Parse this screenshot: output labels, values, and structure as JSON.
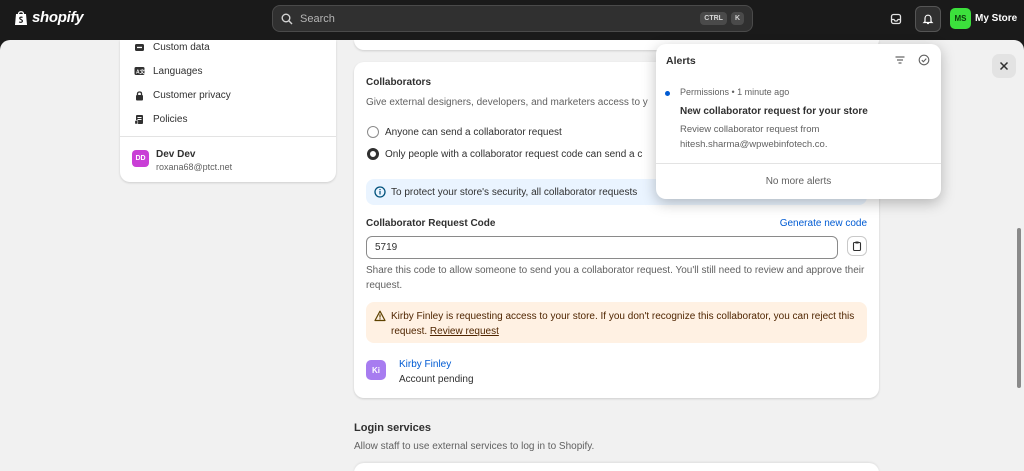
{
  "topbar": {
    "brand": "shopify",
    "search_placeholder": "Search",
    "shortcut_ctrl": "CTRL",
    "shortcut_k": "K",
    "store_initials": "MS",
    "store_name": "My Store"
  },
  "sidebar": {
    "items": [
      {
        "label": "Custom data",
        "icon": "custom-data-icon"
      },
      {
        "label": "Languages",
        "icon": "languages-icon"
      },
      {
        "label": "Customer privacy",
        "icon": "lock-icon"
      },
      {
        "label": "Policies",
        "icon": "policies-icon"
      }
    ],
    "user": {
      "initials": "DD",
      "name": "Dev Dev",
      "email": "roxana68@ptct.net"
    }
  },
  "collaborators": {
    "title": "Collaborators",
    "subtitle": "Give external designers, developers, and marketers access to y",
    "options": [
      {
        "label": "Anyone can send a collaborator request",
        "selected": false
      },
      {
        "label": "Only people with a collaborator request code can send a c",
        "selected": true
      }
    ],
    "info_banner": "To protect your store's security, all collaborator requests",
    "code_label": "Collaborator Request Code",
    "generate_link": "Generate new code",
    "code_value": "5719",
    "help_text": "Share this code to allow someone to send you a collaborator request. You'll still need to review and approve their request.",
    "warning_text": "Kirby Finley is requesting access to your store. If you don't recognize this collaborator, you can reject this request.",
    "warning_link": "Review request",
    "requester": {
      "initials": "Ki",
      "name": "Kirby Finley",
      "status": "Account pending"
    }
  },
  "login_services": {
    "title": "Login services",
    "subtitle": "Allow staff to use external services to log in to Shopify."
  },
  "alerts": {
    "title": "Alerts",
    "item": {
      "meta": "Permissions • 1 minute ago",
      "heading": "New collaborator request for your store",
      "body": "Review collaborator request from hitesh.sharma@wpwebinfotech.co."
    },
    "footer": "No more alerts"
  },
  "colors": {
    "accent": "#005bd3",
    "store_badge": "#3ce03c",
    "warning_bg": "#fff1e3",
    "info_bg": "#eaf4ff"
  }
}
